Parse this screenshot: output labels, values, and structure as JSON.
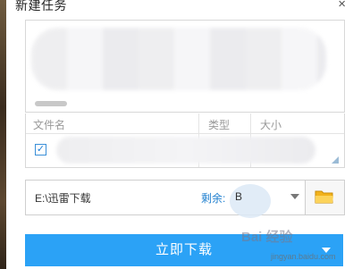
{
  "window": {
    "title": "新建任务",
    "close_glyph": "×"
  },
  "file_table": {
    "columns": [
      "文件名",
      "类型",
      "大小"
    ],
    "checkbox_glyph": "✓"
  },
  "save_path": {
    "path": "E:\\迅雷下载",
    "remaining_label": "剩余:",
    "remaining_value": "B"
  },
  "actions": {
    "download_label": "立即下载"
  },
  "watermark": {
    "logo": "Bai 经验",
    "text": "jingyan.baidu.com"
  },
  "colors": {
    "accent": "#2ba2f6",
    "link": "#1f7fcf",
    "folder": "#f2b21c"
  },
  "icons": {
    "close": "close-icon",
    "folder": "folder-icon",
    "dropdown": "chevron-down-icon"
  }
}
